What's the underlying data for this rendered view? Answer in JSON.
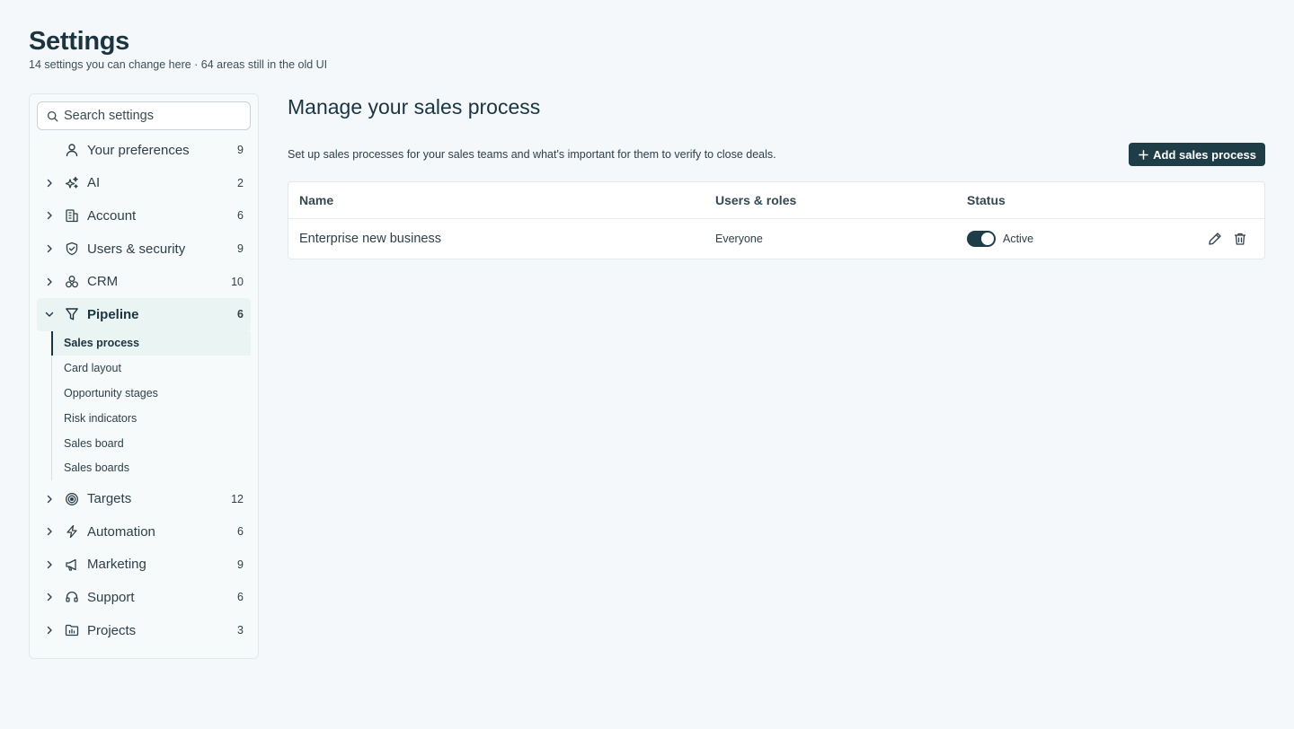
{
  "header": {
    "title": "Settings",
    "subtitle": "14 settings you can change here · 64 areas still in the old UI"
  },
  "sidebar": {
    "search_placeholder": "Search settings",
    "items": [
      {
        "label": "Your preferences",
        "count": "9",
        "icon": "user-icon",
        "expandable": false
      },
      {
        "label": "AI",
        "count": "2",
        "icon": "sparkles-icon",
        "expandable": true
      },
      {
        "label": "Account",
        "count": "6",
        "icon": "building-icon",
        "expandable": true
      },
      {
        "label": "Users & security",
        "count": "9",
        "icon": "shield-check-icon",
        "expandable": true
      },
      {
        "label": "CRM",
        "count": "10",
        "icon": "boxes-icon",
        "expandable": true
      },
      {
        "label": "Pipeline",
        "count": "6",
        "icon": "funnel-icon",
        "expandable": true,
        "expanded": true
      },
      {
        "label": "Targets",
        "count": "12",
        "icon": "target-icon",
        "expandable": true
      },
      {
        "label": "Automation",
        "count": "6",
        "icon": "lightning-icon",
        "expandable": true
      },
      {
        "label": "Marketing",
        "count": "9",
        "icon": "megaphone-icon",
        "expandable": true
      },
      {
        "label": "Support",
        "count": "6",
        "icon": "headset-icon",
        "expandable": true
      },
      {
        "label": "Projects",
        "count": "3",
        "icon": "folder-chart-icon",
        "expandable": true
      }
    ],
    "pipeline_sub": [
      {
        "label": "Sales process",
        "active": true
      },
      {
        "label": "Card layout"
      },
      {
        "label": "Opportunity stages"
      },
      {
        "label": "Risk indicators"
      },
      {
        "label": "Sales board"
      },
      {
        "label": "Sales boards"
      }
    ]
  },
  "main": {
    "title": "Manage your sales process",
    "description": "Set up sales processes for your sales teams and what's important for them to verify to close deals.",
    "add_button": "Add sales process",
    "table": {
      "columns": [
        "Name",
        "Users & roles",
        "Status"
      ],
      "rows": [
        {
          "name": "Enterprise new business",
          "users": "Everyone",
          "status": "Active",
          "enabled": true
        }
      ]
    }
  },
  "colors": {
    "accent": "#1f3d47",
    "active_bg": "#eaf5f3",
    "page_bg": "#f4f8fa"
  }
}
